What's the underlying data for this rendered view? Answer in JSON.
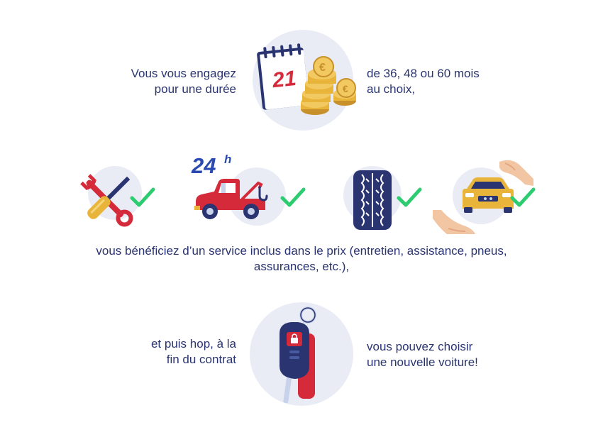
{
  "section1": {
    "left_text_line1": "Vous vous engagez",
    "left_text_line2": "pour une durée",
    "right_text_line1": "de 36, 48 ou 60 mois",
    "right_text_line2": "au choix,",
    "calendar_day": "21"
  },
  "section2": {
    "badge_24": "24",
    "badge_h": "h",
    "text_line1": "vous bénéficiez d’un service inclus dans le prix (entretien, assistance, pneus,",
    "text_line2": "assurances, etc.),",
    "services": [
      "maintenance-tools",
      "tow-truck-assistance",
      "tyre",
      "car-insurance"
    ]
  },
  "section3": {
    "left_text_line1": "et puis hop, à la",
    "left_text_line2": "fin du contrat",
    "right_text_line1": "vous pouvez choisir",
    "right_text_line2": "une nouvelle voiture!"
  },
  "colors": {
    "text": "#2a3470",
    "circle": "#e9ecf5",
    "check": "#2ecc71",
    "red": "#d42a3a",
    "blue": "#2a4ab0",
    "gold": "#e8b43a"
  }
}
